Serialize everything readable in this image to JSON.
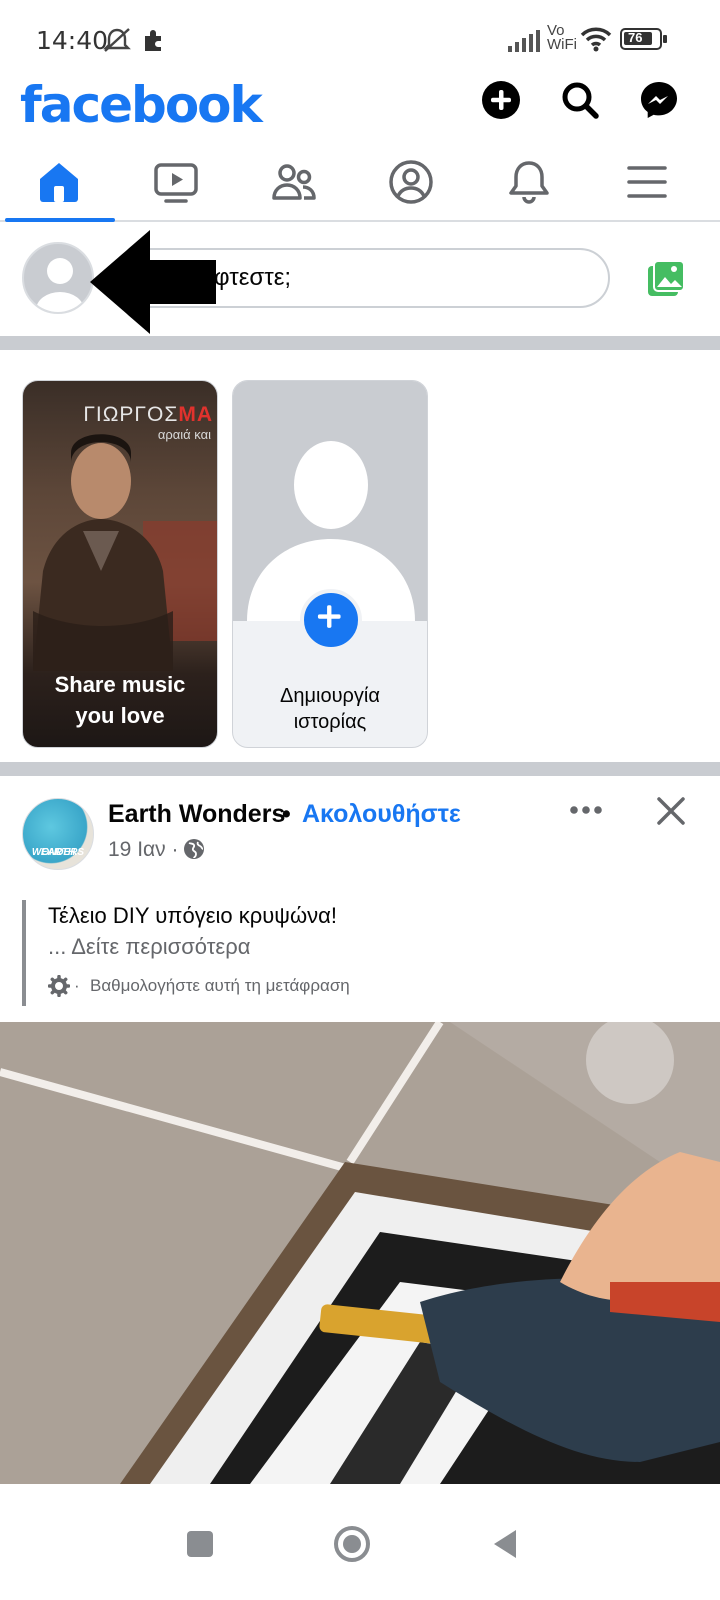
{
  "status": {
    "time": "14:40",
    "vowifi_top": "Vo",
    "vowifi_bottom": "WiFi",
    "battery": "76"
  },
  "header": {
    "logo": "facebook",
    "icons": [
      "plus-icon",
      "search-icon",
      "messenger-icon"
    ]
  },
  "tabs": [
    "home-icon",
    "video-icon",
    "friends-icon",
    "profile-icon",
    "bell-icon",
    "menu-icon"
  ],
  "composer": {
    "text": "φτεστε;"
  },
  "stories": {
    "music": {
      "artist_prefix": "ΓΙΩΡΓΟΣ",
      "artist_suffix": "ΜΑ",
      "artist_sub": "αραιά και",
      "caption_line1": "Share music",
      "caption_line2": "you love"
    },
    "create": {
      "caption_line1": "Δημιουργία",
      "caption_line2": "ιστορίας"
    }
  },
  "post": {
    "avatar_text_1": "EARTH",
    "avatar_text_2": "WONDERS",
    "page_name": "Earth Wonders",
    "separator": "•",
    "follow": "Ακολουθήστε",
    "date": "19 Ιαν ·",
    "text_line1": "Τέλειο DIY υπόγειο κρυψώνα!",
    "see_more": "... Δείτε περισσότερα",
    "translation_rate": "Βαθμολογήστε αυτή τη μετάφραση"
  },
  "colors": {
    "brand": "#1877f2",
    "divider": "#c9ccd1",
    "secondary_text": "#65676b"
  }
}
